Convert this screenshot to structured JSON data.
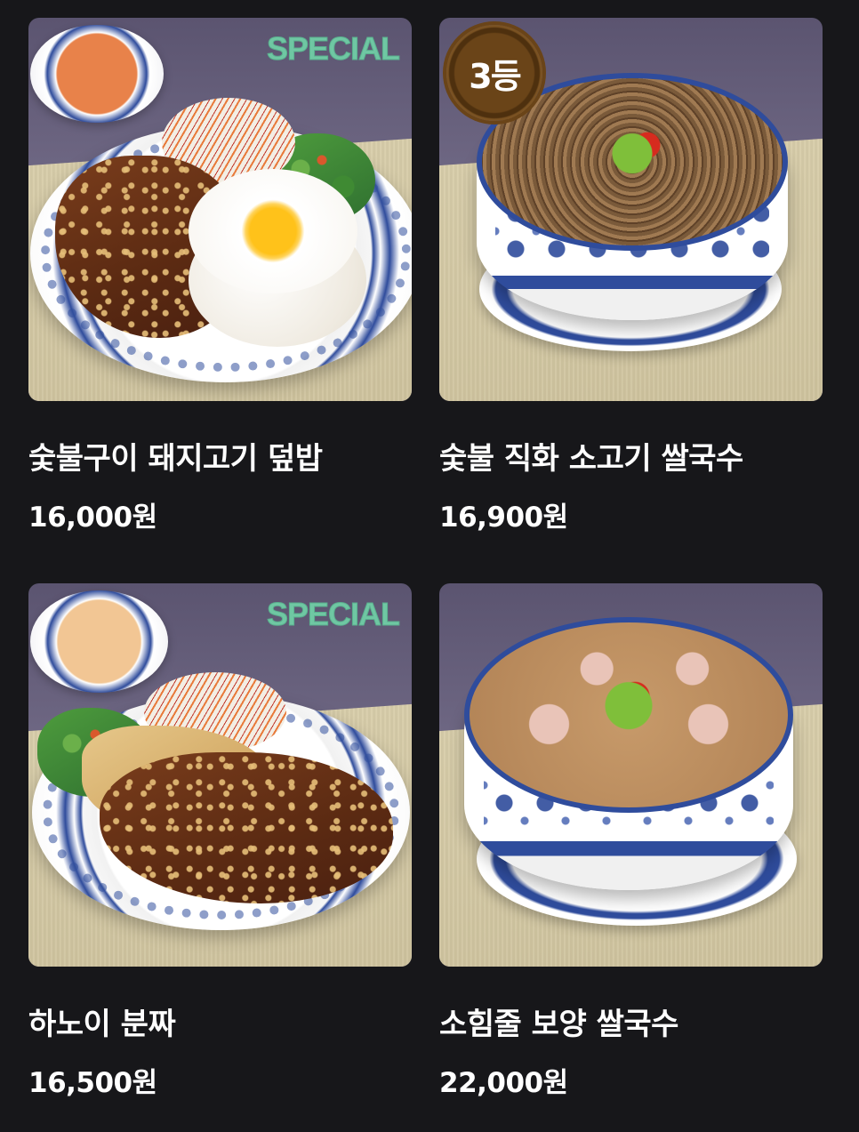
{
  "menu": {
    "items": [
      {
        "name": "숯불구이 돼지고기 덮밥",
        "price": "16,000원",
        "badge": "SPECIAL"
      },
      {
        "name": "숯불 직화 소고기 쌀국수",
        "price": "16,900원",
        "badge": "3등"
      },
      {
        "name": "하노이 분짜",
        "price": "16,500원",
        "badge": "SPECIAL"
      },
      {
        "name": "소힘줄 보양 쌀국수",
        "price": "22,000원",
        "badge": ""
      }
    ]
  },
  "colors": {
    "background": "#17171a",
    "special_badge": "#6fc7a3",
    "rank_badge": "#6a4418",
    "text": "#ffffff"
  }
}
